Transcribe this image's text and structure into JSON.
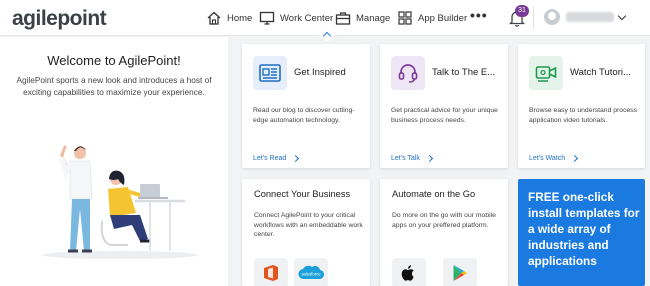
{
  "header": {
    "logo_text": "agilepoint",
    "nav": [
      {
        "label": "Home",
        "icon": "home-icon"
      },
      {
        "label": "Work Center",
        "icon": "monitor-icon"
      },
      {
        "label": "Manage",
        "icon": "briefcase-icon"
      },
      {
        "label": "App Builder",
        "icon": "grid-icon"
      }
    ],
    "more_label": "•••",
    "notification_count": "31",
    "user_name": ""
  },
  "welcome": {
    "title": "Welcome to AgilePoint!",
    "text": "AgilePoint sports a new look and introduces a host of exciting capabilities to maximize your experience."
  },
  "cards": [
    {
      "title": "Get Inspired",
      "desc": "Read our blog to discover cutting-edge automation technology.",
      "link": "Let's Read",
      "icon": "newspaper-icon",
      "icon_bg": "#e6eefb"
    },
    {
      "title": "Talk to The E...",
      "desc": "Get practical advice for your unique business process needs.",
      "link": "Let's Talk",
      "icon": "headset-icon",
      "icon_bg": "#efe6f5"
    },
    {
      "title": "Watch Tutori...",
      "desc": "Browse easy to understand process application video tutorials.",
      "link": "Let's Watch",
      "icon": "video-camera-icon",
      "icon_bg": "#e4f4ea"
    }
  ],
  "lower_cards": [
    {
      "title": "Connect Your Business",
      "desc": "Connect AgilePoint to your critical workflows with an embeddable work center.",
      "tiles": [
        "office-icon",
        "salesforce-icon"
      ]
    },
    {
      "title": "Automate on the Go",
      "desc": "Do more on the go with our mobile apps on your preffered platform.",
      "tiles": [
        "apple-icon",
        "google-play-icon"
      ]
    }
  ],
  "promo": {
    "text": "FREE one-click install templates for a wide array of industries and applications"
  },
  "colors": {
    "accent": "#1f6fc5",
    "promo_bg": "#1a7ae0",
    "badge": "#7a3b96"
  }
}
